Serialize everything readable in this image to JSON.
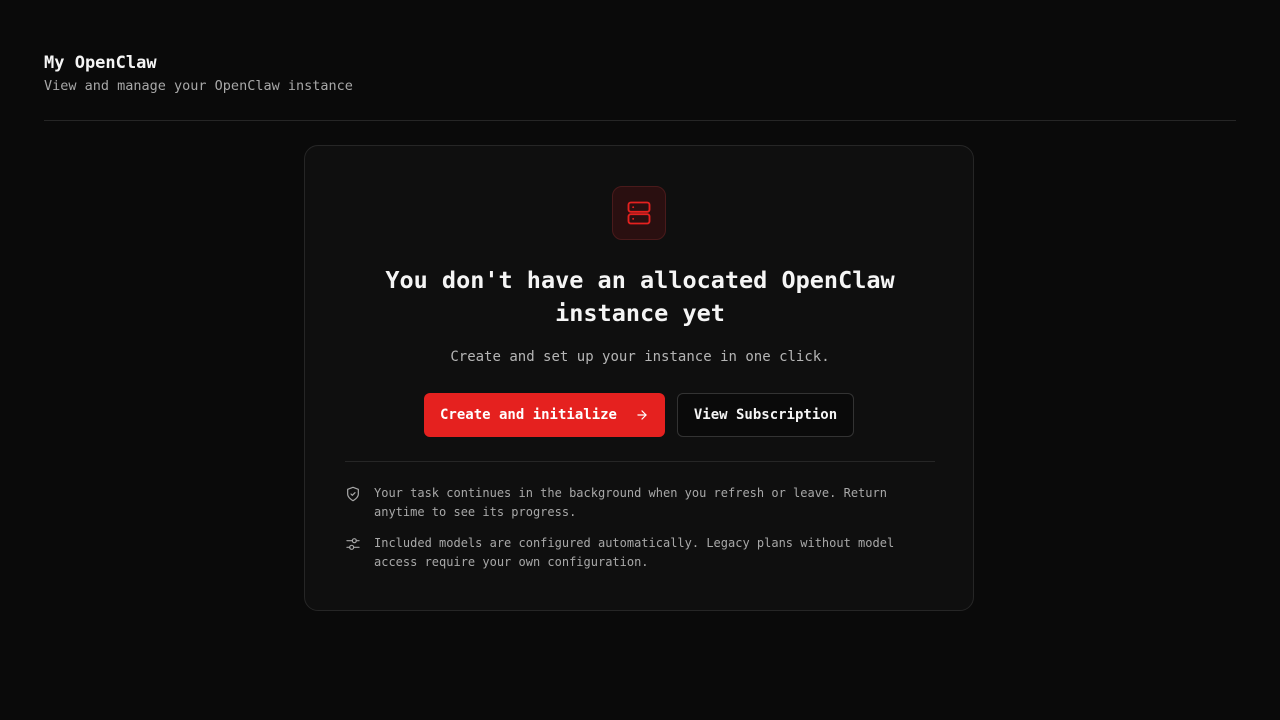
{
  "header": {
    "title": "My OpenClaw",
    "subtitle": "View and manage your OpenClaw instance"
  },
  "empty_state": {
    "icon": "server-icon",
    "title": "You don't have an allocated OpenClaw instance yet",
    "description": "Create and set up your instance in one click.",
    "primary_button": "Create and initialize",
    "secondary_button": "View Subscription",
    "notes": [
      {
        "icon": "shield-check-icon",
        "text": "Your task continues in the background when you refresh or leave. Return anytime to see its progress."
      },
      {
        "icon": "sliders-icon",
        "text": "Included models are configured automatically. Legacy plans without model access require your own configuration."
      }
    ]
  },
  "colors": {
    "background": "#0a0a0a",
    "card": "#0f0f0f",
    "accent": "#e5211f",
    "border": "#262626"
  }
}
